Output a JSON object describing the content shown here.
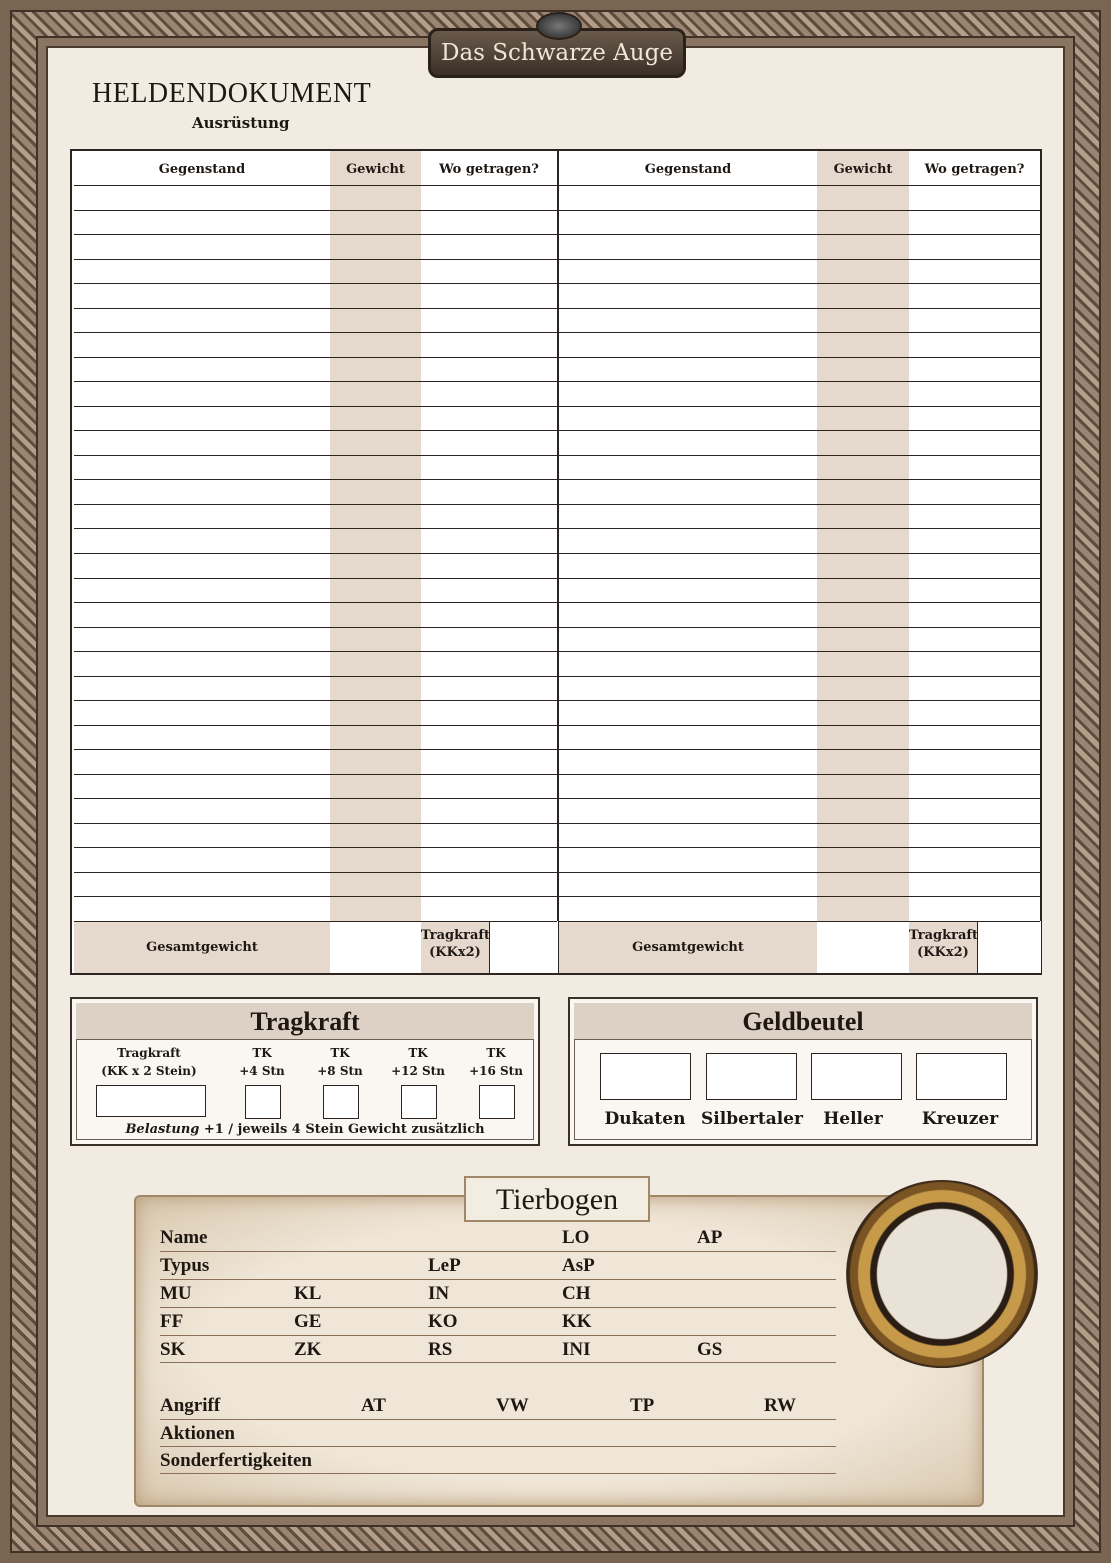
{
  "logo": {
    "text": "Das Schwarze Auge"
  },
  "document": {
    "title": "HELDENDOKUMENT",
    "subtitle": "Ausrüstung"
  },
  "inventory": {
    "columns": {
      "item": "Gegenstand",
      "weight": "Gewicht",
      "location": "Wo getragen?"
    },
    "rows_per_side": 30,
    "footer": {
      "total_label": "Gesamtgewicht",
      "capacity_label_line1": "Tragkraft",
      "capacity_label_line2": "(KKx2)"
    }
  },
  "tragkraft": {
    "title": "Tragkraft",
    "fields": [
      {
        "line1": "Tragkraft",
        "line2": "(KK x 2 Stein)"
      },
      {
        "line1": "TK",
        "line2": "+4 Stn"
      },
      {
        "line1": "TK",
        "line2": "+8 Stn"
      },
      {
        "line1": "TK",
        "line2": "+12 Stn"
      },
      {
        "line1": "TK",
        "line2": "+16 Stn"
      }
    ],
    "note_italic": "Belastung",
    "note_rest": " +1 / jeweils 4 Stein Gewicht  zusätzlich"
  },
  "geldbeutel": {
    "title": "Geldbeutel",
    "coins": [
      "Dukaten",
      "Silbertaler",
      "Heller",
      "Kreuzer"
    ]
  },
  "tierbogen": {
    "title": "Tierbogen",
    "rows": [
      [
        "Name",
        "",
        "",
        "LO",
        "AP"
      ],
      [
        "Typus",
        "",
        "LeP",
        "AsP",
        ""
      ],
      [
        "MU",
        "KL",
        "IN",
        "CH",
        ""
      ],
      [
        "FF",
        "GE",
        "KO",
        "KK",
        ""
      ],
      [
        "SK",
        "ZK",
        "RS",
        "INI",
        "GS"
      ]
    ],
    "attack": {
      "label": "Angriff",
      "at": "AT",
      "vw": "VW",
      "tp": "TP",
      "rw": "RW"
    },
    "actions": "Aktionen",
    "special": "Sonderfertigkeiten"
  }
}
